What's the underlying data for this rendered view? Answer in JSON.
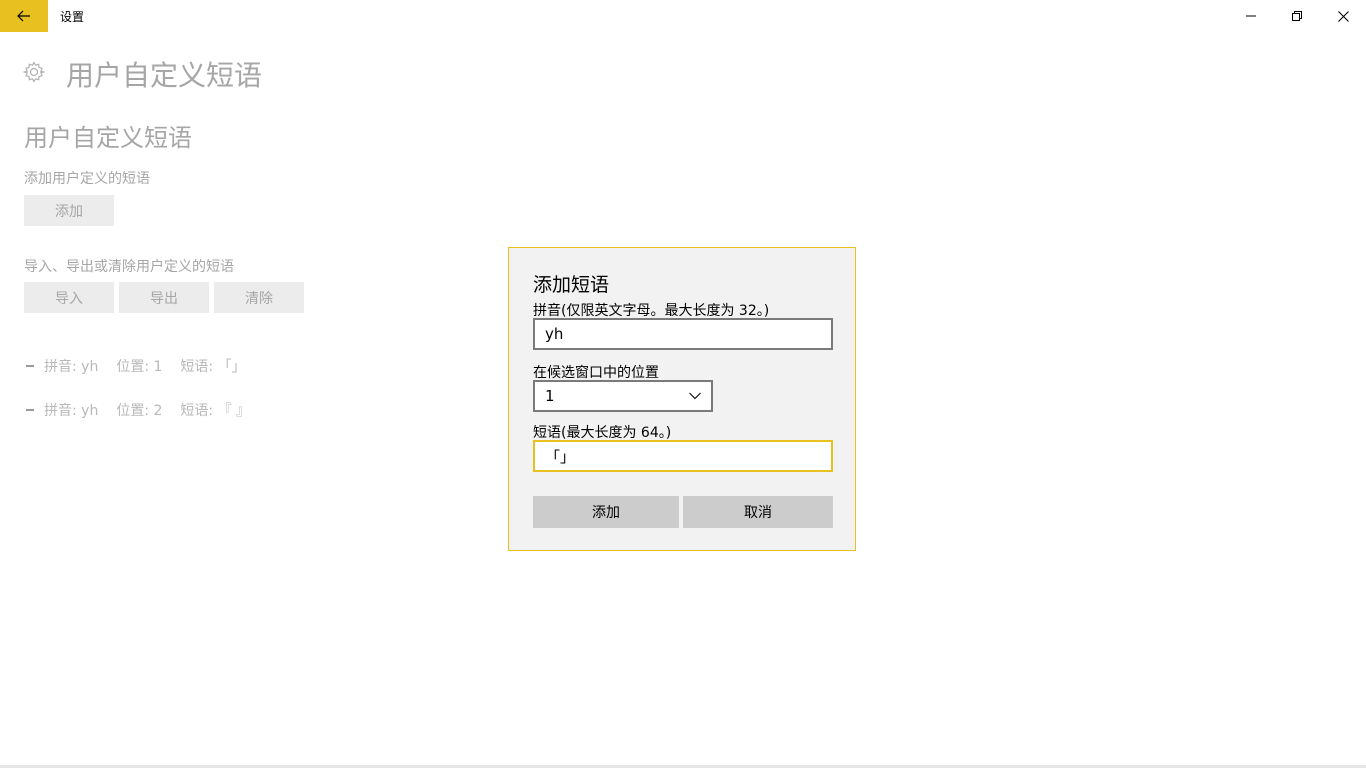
{
  "window": {
    "title": "设置",
    "accent": "#e8c01f"
  },
  "icons": {
    "back": "back-arrow-icon",
    "minimize": "minimize-icon",
    "restore": "restore-icon",
    "close": "close-icon",
    "settings": "gear-icon",
    "dropdown": "chevron-down-icon"
  },
  "page": {
    "title": "用户自定义短语",
    "section_title": "用户自定义短语",
    "add_desc": "添加用户定义的短语",
    "add_button": "添加",
    "manage_desc": "导入、导出或清除用户定义的短语",
    "import_button": "导入",
    "export_button": "导出",
    "clear_button": "清除",
    "phrases": [
      {
        "pinyin": "拼音: yh",
        "position": "位置: 1",
        "phrase": "短语: 「」"
      },
      {
        "pinyin": "拼音: yh",
        "position": "位置: 2",
        "phrase": "短语: 『 』"
      }
    ]
  },
  "dialog": {
    "title": "添加短语",
    "pinyin_label": "拼音(仅限英文字母。最大长度为 32。)",
    "pinyin_value": "yh",
    "position_label": "在候选窗口中的位置",
    "position_value": "1",
    "phrase_label": "短语(最大长度为 64。)",
    "phrase_value": "「」",
    "add_button": "添加",
    "cancel_button": "取消"
  }
}
